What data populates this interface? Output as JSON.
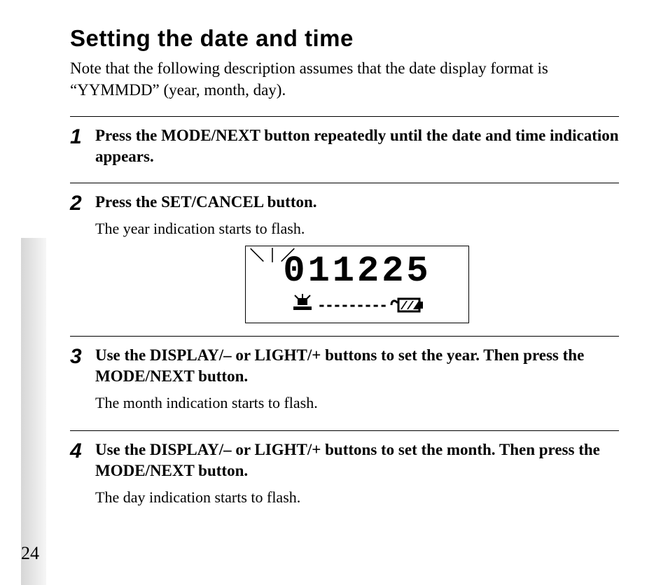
{
  "title": "Setting the date and time",
  "note": "Note that the following description assumes that the date display format is “YYMMDD” (year, month, day).",
  "steps": [
    {
      "num": "1",
      "head": "Press the MODE/NEXT button repeatedly until the date and time indication appears."
    },
    {
      "num": "2",
      "head": "Press the SET/CANCEL button.",
      "sub": "The year indication starts to flash.",
      "lcd": {
        "digits": "011225",
        "dashes": "---------",
        "icons": {
          "base": "base-station-icon",
          "battery": "battery-icon"
        }
      }
    },
    {
      "num": "3",
      "head": "Use the DISPLAY/– or LIGHT/+ buttons to set the year. Then press the MODE/NEXT button.",
      "sub": "The month indication starts to flash."
    },
    {
      "num": "4",
      "head": "Use the DISPLAY/– or LIGHT/+ buttons to set the month. Then press the MODE/NEXT button.",
      "sub": "The day indication starts to flash."
    }
  ],
  "pageNumber": "24"
}
